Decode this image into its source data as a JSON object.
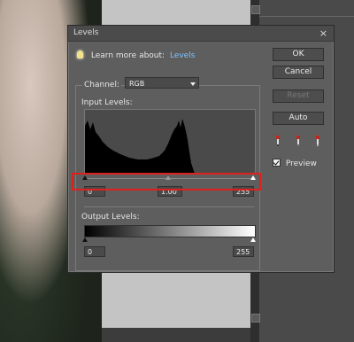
{
  "dialog": {
    "title": "Levels",
    "close": "×",
    "learn_text": "Learn more about:",
    "learn_link": "Levels",
    "channel_label": "Channel:",
    "channel_value": "RGB",
    "input_levels_label": "Input Levels:",
    "input_black": "0",
    "input_gamma": "1.00",
    "input_white": "255",
    "output_levels_label": "Output Levels:",
    "output_black": "0",
    "output_white": "255",
    "buttons": {
      "ok": "OK",
      "cancel": "Cancel",
      "reset": "Reset",
      "auto": "Auto"
    },
    "preview_label": "Preview",
    "preview_checked": true
  },
  "icons": {
    "bulb": "lightbulb-icon",
    "close": "close-icon",
    "dropdown": "chevron-down-icon",
    "eyedroppers": [
      "black-eyedropper-icon",
      "gray-eyedropper-icon",
      "white-eyedropper-icon"
    ]
  },
  "colors": {
    "highlight": "#e0201b",
    "link": "#7ec4ff",
    "eyedropper": "#c0281c"
  }
}
